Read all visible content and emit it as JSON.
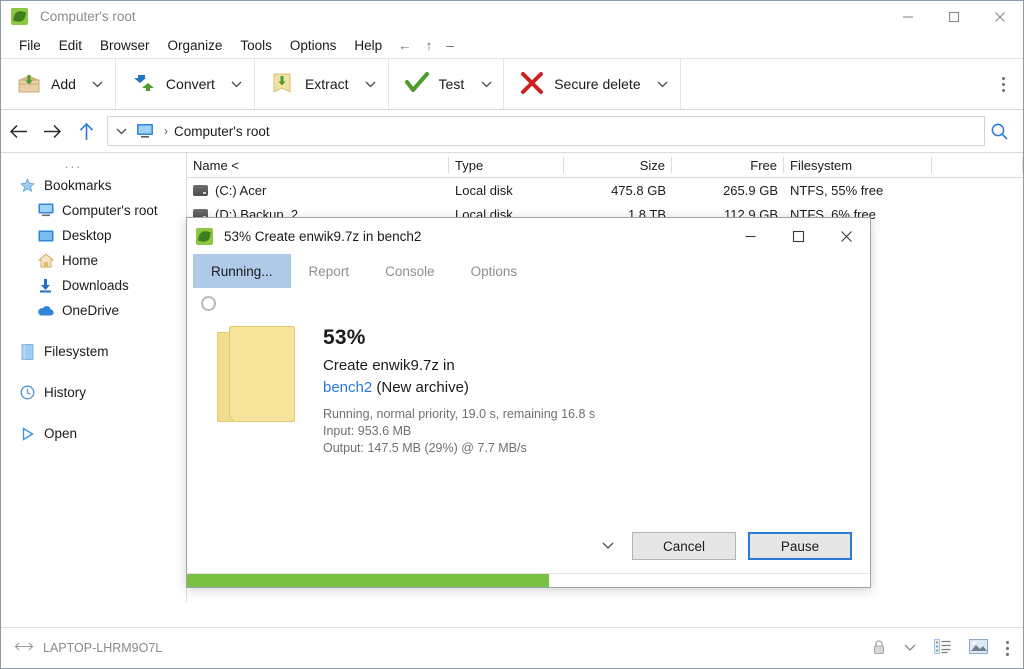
{
  "window": {
    "title": "Computer's root",
    "app_icon": "peazip-icon",
    "controls": {
      "minimize": "minimize-icon",
      "maximize": "maximize-icon",
      "close": "close-icon"
    }
  },
  "menubar": {
    "items": [
      "File",
      "Edit",
      "Browser",
      "Organize",
      "Tools",
      "Options",
      "Help"
    ],
    "glyphs": [
      "←",
      "↑",
      "–"
    ]
  },
  "toolbar": {
    "buttons": [
      {
        "label": "Add",
        "icon": "add-archive-icon"
      },
      {
        "label": "Convert",
        "icon": "convert-icon"
      },
      {
        "label": "Extract",
        "icon": "extract-icon"
      },
      {
        "label": "Test",
        "icon": "test-check-icon"
      },
      {
        "label": "Secure delete",
        "icon": "secure-delete-icon"
      }
    ],
    "overflow": "more-options-icon"
  },
  "addressbar": {
    "back": "back-arrow-icon",
    "forward": "forward-arrow-icon",
    "up": "up-arrow-icon",
    "dropdown": "chevron-down-icon",
    "location_icon": "computer-icon",
    "separator": "›",
    "path": "Computer's root",
    "search": "search-icon"
  },
  "sidebar": {
    "overflow": "...",
    "items": [
      {
        "label": "Bookmarks",
        "icon": "star-icon",
        "level": 0
      },
      {
        "label": "Computer's root",
        "icon": "computer-icon",
        "level": 1
      },
      {
        "label": "Desktop",
        "icon": "desktop-icon",
        "level": 1
      },
      {
        "label": "Home",
        "icon": "home-icon",
        "level": 1
      },
      {
        "label": "Downloads",
        "icon": "download-icon",
        "level": 1
      },
      {
        "label": "OneDrive",
        "icon": "cloud-icon",
        "level": 1
      },
      {
        "label": "Filesystem",
        "icon": "filesystem-icon",
        "level": 0,
        "gap": true
      },
      {
        "label": "History",
        "icon": "clock-icon",
        "level": 0,
        "gap": true
      },
      {
        "label": "Open",
        "icon": "play-icon",
        "level": 0,
        "gap": true
      }
    ]
  },
  "filelist": {
    "columns": [
      "Name <",
      "Type",
      "Size",
      "Free",
      "Filesystem"
    ],
    "rows": [
      {
        "name": "(C:) Acer",
        "type": "Local disk",
        "size": "475.8 GB",
        "free": "265.9 GB",
        "filesystem": "NTFS, 55% free",
        "icon": "drive-icon"
      },
      {
        "name": "(D:) Backup_2",
        "type": "Local disk",
        "size": "1.8 TB",
        "free": "112.9 GB",
        "filesystem": "NTFS, 6% free",
        "icon": "drive-icon"
      }
    ]
  },
  "statusbar": {
    "resize_icon": "resize-splitter-icon",
    "machine": "LAPTOP-LHRM9O7L",
    "lock_icon": "lock-icon",
    "chevron_icon": "chevron-down-icon",
    "list_view_icon": "list-view-icon",
    "thumbnail_icon": "thumbnail-view-icon",
    "menu_icon": "more-options-icon"
  },
  "dialog": {
    "app_icon": "peazip-icon",
    "title": "53% Create enwik9.7z in bench2",
    "controls": {
      "minimize": "minimize-icon",
      "maximize": "maximize-icon",
      "close": "close-icon"
    },
    "tabs": [
      {
        "label": "Running...",
        "active": true
      },
      {
        "label": "Report",
        "active": false
      },
      {
        "label": "Console",
        "active": false
      },
      {
        "label": "Options",
        "active": false
      }
    ],
    "spinner": "busy-spinner-icon",
    "folder_icon": "folder-icon",
    "percent": "53%",
    "operation": "Create enwik9.7z in",
    "target": "bench2",
    "target_suffix": " (New archive)",
    "status_line": "Running, normal priority, 19.0 s, remaining 16.8 s",
    "input_line": "Input: 953.6 MB",
    "output_line": "Output: 147.5 MB (29%) @ 7.7 MB/s",
    "footer_caret": "chevron-down-icon",
    "cancel_label": "Cancel",
    "pause_label": "Pause",
    "progress_percent": 53,
    "progress_color": "#7ac143"
  }
}
